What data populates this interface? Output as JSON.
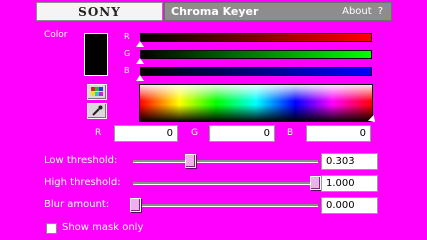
{
  "header": {
    "brand": "SONY",
    "title": "Chroma Keyer",
    "about_label": "About",
    "help_label": "?"
  },
  "color": {
    "label": "Color",
    "swatch_color": "#000000",
    "bar_labels": {
      "r": "R",
      "g": "G",
      "b": "B"
    },
    "channel_fractions": {
      "r": 0,
      "g": 0,
      "b": 0
    }
  },
  "icons": {
    "palette": "color-palette-icon",
    "picker": "eyedropper-icon"
  },
  "rgb_fields": [
    {
      "label": "R",
      "value": "0"
    },
    {
      "label": "G",
      "value": "0"
    },
    {
      "label": "B",
      "value": "0"
    }
  ],
  "sliders": [
    {
      "label": "Low threshold:",
      "value": "0.303",
      "fraction": 0.303
    },
    {
      "label": "High threshold:",
      "value": "1.000",
      "fraction": 1.0
    },
    {
      "label": "Blur amount:",
      "value": "0.000",
      "fraction": 0.0
    }
  ],
  "show_mask": {
    "label": "Show mask only",
    "checked": false
  },
  "colors": {
    "background": "#ff00ff",
    "title_bar": "#8d8d8d"
  }
}
